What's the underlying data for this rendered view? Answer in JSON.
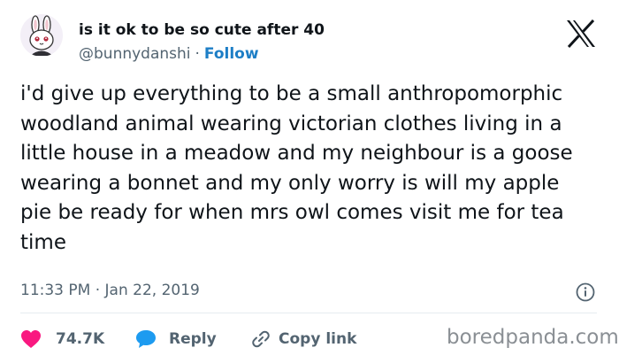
{
  "author": {
    "display_name": "is it ok to be so cute after 40",
    "handle": "@bunnydanshi",
    "separator": "·",
    "follow_label": "Follow",
    "avatar_icon": "bunny-avatar-icon"
  },
  "brand": {
    "logo_icon": "x-logo-icon"
  },
  "tweet": {
    "text": "i'd give up everything to be a small anthropomorphic woodland animal wearing victorian clothes living in a little house in a meadow and my neighbour is a goose wearing a bonnet and my only worry is will my apple pie be ready for when mrs owl comes visit me for tea time",
    "time": "11:33 PM",
    "date_separator": "·",
    "date": "Jan 22, 2019"
  },
  "actions": {
    "like_count": "74.7K",
    "reply_label": "Reply",
    "copy_link_label": "Copy link"
  },
  "watermark": "boredpanda.com",
  "colors": {
    "text": "#0f1419",
    "secondary": "#536471",
    "link": "#1d7ec6",
    "like": "#f91880",
    "reply": "#1d9bf0"
  }
}
